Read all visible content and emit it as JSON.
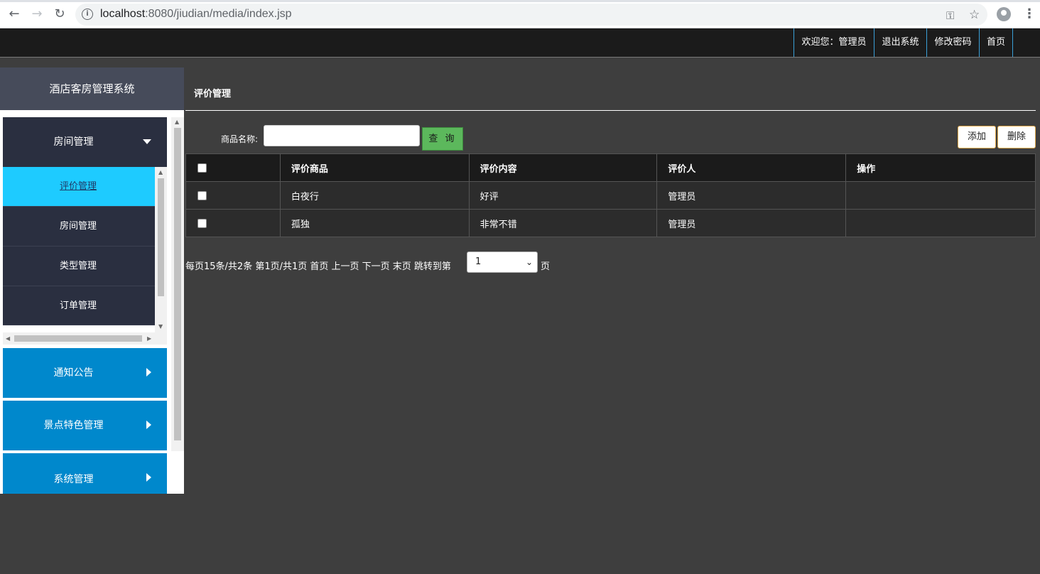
{
  "browser": {
    "url_host": "localhost",
    "url_rest": ":8080/jiudian/media/index.jsp"
  },
  "topnav": {
    "welcome": "欢迎您：管理员",
    "logout": "退出系统",
    "change_password": "修改密码",
    "home": "首页"
  },
  "sidebar": {
    "brand": "酒店客房管理系统",
    "groups": [
      {
        "label": "房间管理",
        "expanded": true
      },
      {
        "label": "通知公告",
        "expanded": false
      },
      {
        "label": "景点特色管理",
        "expanded": false
      },
      {
        "label": "系统管理",
        "expanded": false
      }
    ],
    "items": [
      {
        "label": "评价管理",
        "active": true
      },
      {
        "label": "房间管理",
        "active": false
      },
      {
        "label": "类型管理",
        "active": false
      },
      {
        "label": "订单管理",
        "active": false
      }
    ]
  },
  "main": {
    "title": "评价管理",
    "search_label": "商品名称:",
    "search_value": "",
    "query_button": "查 询",
    "add_button": "添加",
    "delete_button": "删除",
    "table": {
      "headers": [
        "",
        "评价商品",
        "评价内容",
        "评价人",
        "操作"
      ],
      "rows": [
        {
          "product": "白夜行",
          "content": "好评",
          "reviewer": "管理员",
          "ops": ""
        },
        {
          "product": "孤独",
          "content": "非常不错",
          "reviewer": "管理员",
          "ops": ""
        }
      ]
    },
    "pager": {
      "text": "每页15条/共2条 第1页/共1页 首页 上一页 下一页 末页 跳转到第",
      "selected_page": "1",
      "suffix": "页"
    }
  },
  "colors": {
    "active_item": "#1ecbff",
    "group_blue": "#0088cc",
    "query_green": "#5cb85c",
    "topbar": "#1b1b1b",
    "background": "#3e3e3e"
  }
}
